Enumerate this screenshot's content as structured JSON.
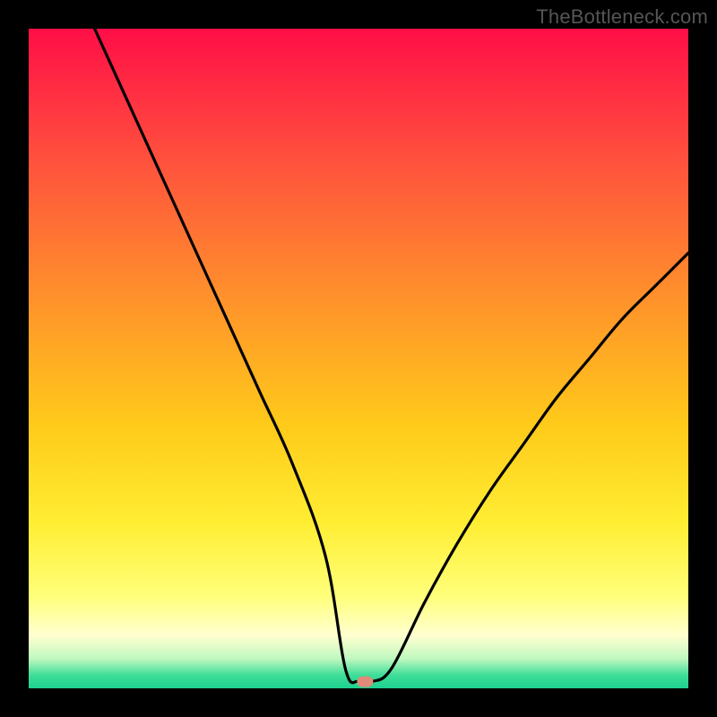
{
  "watermark": "TheBottleneck.com",
  "chart_data": {
    "type": "line",
    "title": "",
    "xlabel": "",
    "ylabel": "",
    "xlim": [
      0,
      100
    ],
    "ylim": [
      0,
      100
    ],
    "x": [
      10,
      15,
      20,
      25,
      30,
      35,
      40,
      45,
      48,
      50,
      52,
      55,
      60,
      65,
      70,
      75,
      80,
      85,
      90,
      95,
      100
    ],
    "values": [
      100,
      89,
      78,
      67,
      56,
      45,
      34,
      20,
      3,
      1,
      1,
      3,
      13,
      22,
      30,
      37,
      44,
      50,
      56,
      61,
      66
    ],
    "grid": false,
    "gradient_bg": {
      "stops": [
        {
          "pos": 0.0,
          "color": "#ff0e47"
        },
        {
          "pos": 0.2,
          "color": "#ff513d"
        },
        {
          "pos": 0.4,
          "color": "#ff8f2c"
        },
        {
          "pos": 0.6,
          "color": "#ffca1a"
        },
        {
          "pos": 0.75,
          "color": "#ffee33"
        },
        {
          "pos": 0.86,
          "color": "#ffff7a"
        },
        {
          "pos": 0.92,
          "color": "#ffffd0"
        },
        {
          "pos": 0.955,
          "color": "#c0f8c0"
        },
        {
          "pos": 0.98,
          "color": "#3fdd98"
        },
        {
          "pos": 1.0,
          "color": "#1dd08f"
        }
      ]
    },
    "marker": {
      "x": 51,
      "y": 1,
      "color": "#e08a7a",
      "label": ""
    }
  }
}
